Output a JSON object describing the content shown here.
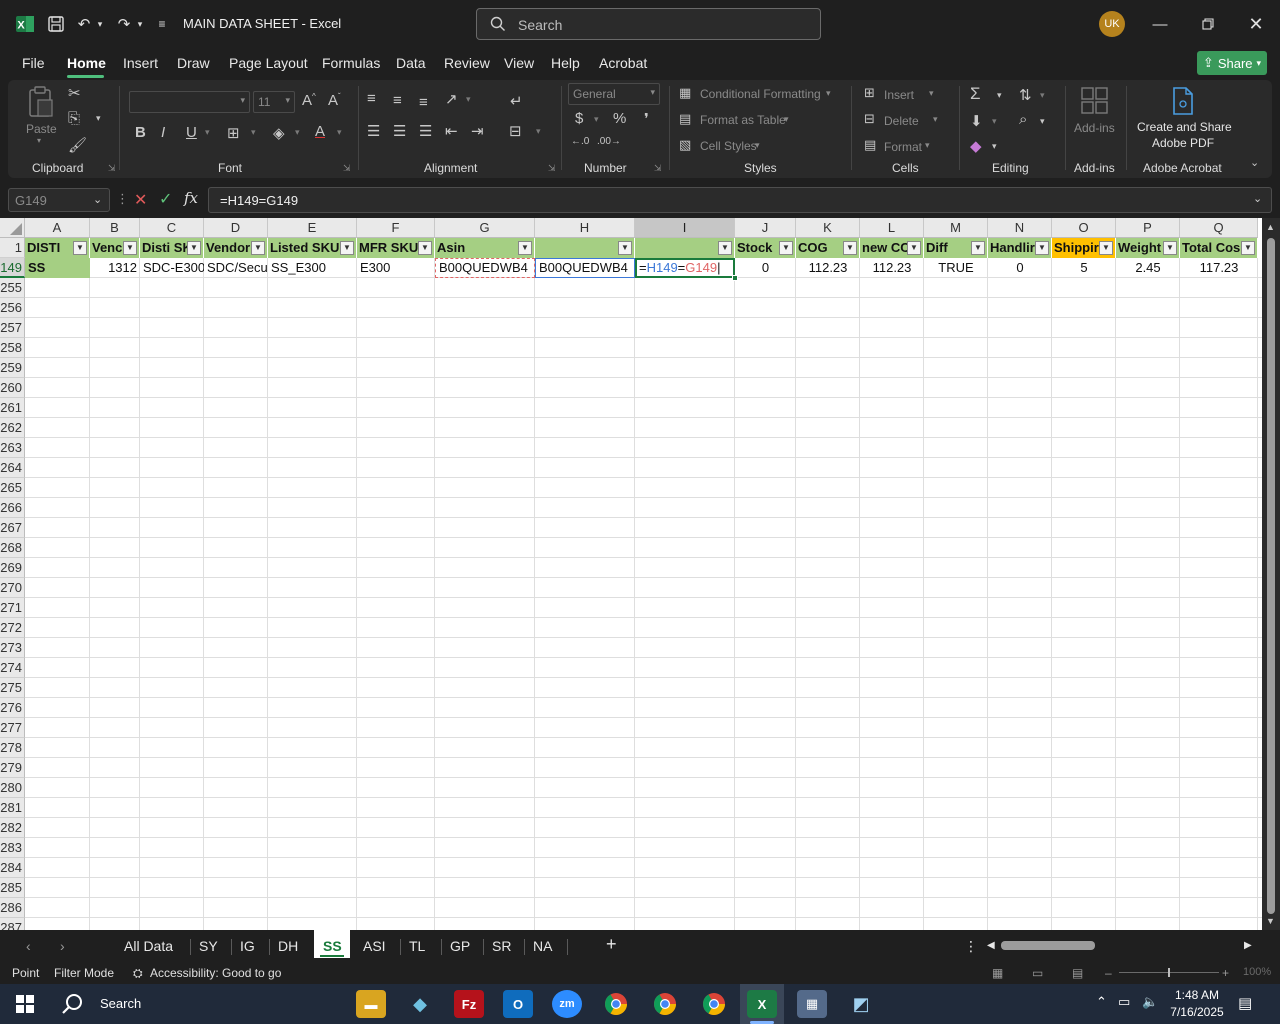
{
  "window": {
    "app_icon": "excel-icon",
    "title": "MAIN DATA SHEET  -  Excel",
    "search_placeholder": "Search",
    "user_initials": "UK"
  },
  "menu": {
    "items": [
      "File",
      "Home",
      "Insert",
      "Draw",
      "Page Layout",
      "Formulas",
      "Data",
      "Review",
      "View",
      "Help",
      "Acrobat"
    ],
    "active": "Home",
    "share_label": "Share"
  },
  "ribbon": {
    "clipboard": {
      "label": "Clipboard",
      "paste": "Paste"
    },
    "font": {
      "label": "Font",
      "size": "11"
    },
    "alignment": {
      "label": "Alignment"
    },
    "number": {
      "label": "Number",
      "format": "General"
    },
    "styles": {
      "label": "Styles",
      "conditional": "Conditional Formatting",
      "format_table": "Format as Table",
      "cell_styles": "Cell Styles"
    },
    "cells": {
      "label": "Cells",
      "insert": "Insert",
      "delete": "Delete",
      "format": "Format"
    },
    "editing": {
      "label": "Editing"
    },
    "addins": {
      "label": "Add-ins",
      "button": "Add-ins"
    },
    "acrobat": {
      "label": "Adobe Acrobat",
      "button_line1": "Create and Share",
      "button_line2": "Adobe PDF"
    }
  },
  "formula_bar": {
    "name_box": "G149",
    "formula": "=H149=G149"
  },
  "sheet": {
    "columns": [
      "A",
      "B",
      "C",
      "D",
      "E",
      "F",
      "G",
      "H",
      "I",
      "J",
      "K",
      "L",
      "M",
      "N",
      "O",
      "P",
      "Q"
    ],
    "selected_column": "I",
    "header_row_number": "1",
    "headers": [
      "DISTI",
      "Venc",
      "Disti SK",
      "Vendor",
      "Listed SKU",
      "MFR SKU",
      "Asin",
      "",
      "",
      "Stock",
      "COG",
      "new CC",
      "Diff",
      "Handlir",
      "Shippir",
      "Weight",
      "Total Cos"
    ],
    "data_row_number": "149",
    "data_row": [
      "SS",
      "1312",
      "SDC-E300",
      "SDC/Secu",
      "SS_E300",
      "E300",
      "B00QUEDWB4",
      "B00QUEDWB4",
      "",
      "0",
      "112.23",
      "112.23",
      "TRUE",
      "0",
      "5",
      "2.45",
      "117.23"
    ],
    "editing_formula": {
      "prefix": "=",
      "ref1": "H149",
      "op": "=",
      "ref2": "G149"
    },
    "empty_rows": [
      "255",
      "256",
      "257",
      "258",
      "259",
      "260",
      "261",
      "262",
      "263",
      "264",
      "265",
      "266",
      "267",
      "268",
      "269",
      "270",
      "271",
      "272",
      "273",
      "274",
      "275",
      "276",
      "277",
      "278",
      "279",
      "280",
      "281",
      "282",
      "283",
      "284",
      "285",
      "286",
      "287"
    ]
  },
  "tabs": {
    "items": [
      "All Data",
      "SY",
      "IG",
      "DH",
      "SS",
      "ASI",
      "TL",
      "GP",
      "SR",
      "NA"
    ],
    "active": "SS"
  },
  "status": {
    "mode": "Point",
    "filter": "Filter Mode",
    "accessibility": "Accessibility: Good to go",
    "zoom": "100%"
  },
  "taskbar": {
    "search": "Search",
    "time": "1:48 AM",
    "date": "7/16/2025"
  },
  "colors": {
    "header_green": "#a5cf83",
    "header_yellow": "#ffc000",
    "excel_green": "#1a7b3c",
    "share_green": "#3a9a5b",
    "ref_blue": "#3c78d8",
    "ref_red": "#e06666"
  }
}
